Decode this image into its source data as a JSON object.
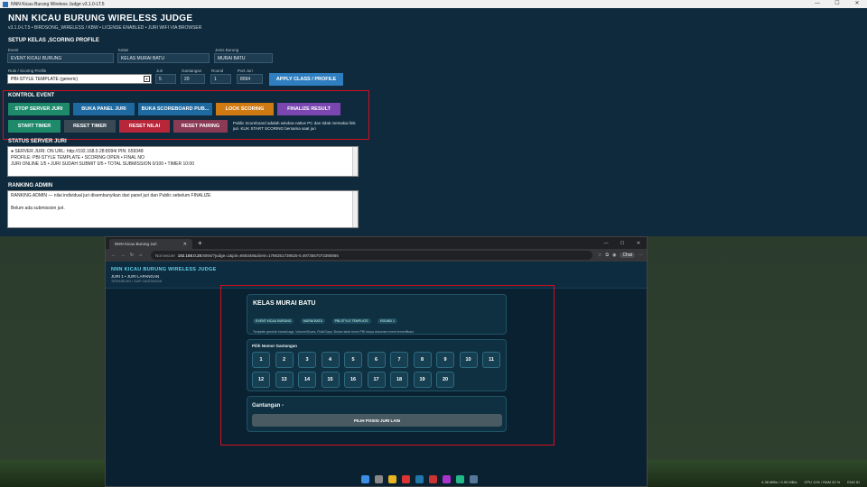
{
  "app": {
    "window_title": "NNN Kicau Burung Wireless Judge v3.1.0-LT.5",
    "title": "NNN KICAU BURUNG WIRELESS JUDGE",
    "subtitle": "v3.1.0-LT.5  •  BIRDSONG_WIRELESS / KBW  •  LICENSE ENABLED  •  JURI WIFI VIA BROWSER",
    "setup": {
      "heading": "SETUP KELAS ,SCORING PROFILE",
      "event_label": "Event",
      "event_value": "EVENT KICAU BURUNG",
      "kelas_label": "Kelas",
      "kelas_value": "KELAS MURAI BATU",
      "jenis_label": "Jenis Burung",
      "jenis_value": "MURAI BATU",
      "rule_label": "Rule / Scoring Profile",
      "rule_value": "PBI-STYLE TEMPLATE (generic)",
      "juri_label": "Juri",
      "juri_value": "5",
      "gantangan_label": "Gantangan",
      "gantangan_value": "20",
      "round_label": "Round",
      "round_value": "1",
      "port_label": "Port Juri",
      "port_value": "8094",
      "apply_button": "APPLY CLASS / PROFILE"
    },
    "kontrol": {
      "heading": "KONTROL EVENT",
      "stop_server": "STOP SERVER JURI",
      "buka_panel": "BUKA PANEL JURI",
      "buka_scoreboard": "BUKA SCOREBOARD PUB...",
      "lock_scoring": "LOCK SCORING",
      "finalize": "FINALIZE RESULT",
      "start_timer": "START TIMER",
      "reset_timer": "RESET TIMER",
      "reset_nilai": "RESET NILAI",
      "reset_pairing": "RESET PAIRING",
      "note": "Public Scoreboard adalah window native PC dan tidak memakai link juri. KLIK START SCORING bersama saat juri"
    },
    "status": {
      "heading": "STATUS SERVER JURI",
      "line1": "● SERVER JURI: ON    URL: http://192.168.0.28:8094/    PIN: 659348",
      "line2": "PROFILE: PBI-STYLE TEMPLATE   •   SCORING OPEN   •   FINAL NO",
      "line3": "JURI ONLINE 1/5   •   JURI SUDAH SUBMIT 0/5   •   TOTAL SUBMISSION 0/100   •   TIMER 10:00"
    },
    "ranking": {
      "heading": "RANKING ADMIN",
      "line1": "RANKING ADMIN — nilai individual juri disembunyikan dari panel juri dan Public sebelum FINALIZE",
      "line2": "Belum ada submission juri."
    }
  },
  "browser": {
    "tab_title": "NNN Kicau Burung Juri",
    "url_prefix": "Not secure",
    "url_host": "192.168.0.28",
    "url_rest": ":8094/?judge=1&pin=659348&client=1786351739525-0.4973567073390866",
    "chat": "Chat",
    "page": {
      "title": "NNN KICAU BURUNG WIRELESS JUDGE",
      "sub": "JURI 1 • JURI LAPANGAN",
      "sub2": "TERHUBUNG • SIAP GANTANGAN",
      "kelas_title": "KELAS MURAI BATU",
      "chips": [
        "EVENT KICAU BURUNG",
        "MURAI BATU",
        "PBI-STYLE TEMPLATE",
        "ROUND 1"
      ],
      "kelas_desc": "Template generik Irama/Lagu, Volume/Suara, Fisik/Gaya. Bukan tabel resmi PBI tanpa dokumen event terverifikasi.",
      "pilih_label": "Pilih Nomor Gantangan",
      "numbers": [
        "1",
        "2",
        "3",
        "4",
        "5",
        "6",
        "7",
        "8",
        "9",
        "10",
        "11",
        "12",
        "13",
        "14",
        "15",
        "16",
        "17",
        "18",
        "19",
        "20"
      ],
      "gantangan_label": "Gantangan -",
      "pilih_button": "PILIH POSISI JURI LAIN"
    }
  },
  "tray": {
    "weather": "4.38 MB/s  /  0.90 MB/s",
    "cpu": "CPU 11%  /  RAM 32 %",
    "lang": "ENG  ID"
  },
  "colors": {
    "app_bg": "#0f2a3c",
    "red_highlight": "#d01020",
    "btn_green": "#1e8a6a",
    "btn_blue": "#1e6aa0",
    "btn_orange": "#d07a14",
    "btn_purple": "#7b46b0",
    "btn_red": "#b8263a",
    "btn_gray": "#3a4a55",
    "btn_maroon": "#8a3a55"
  }
}
